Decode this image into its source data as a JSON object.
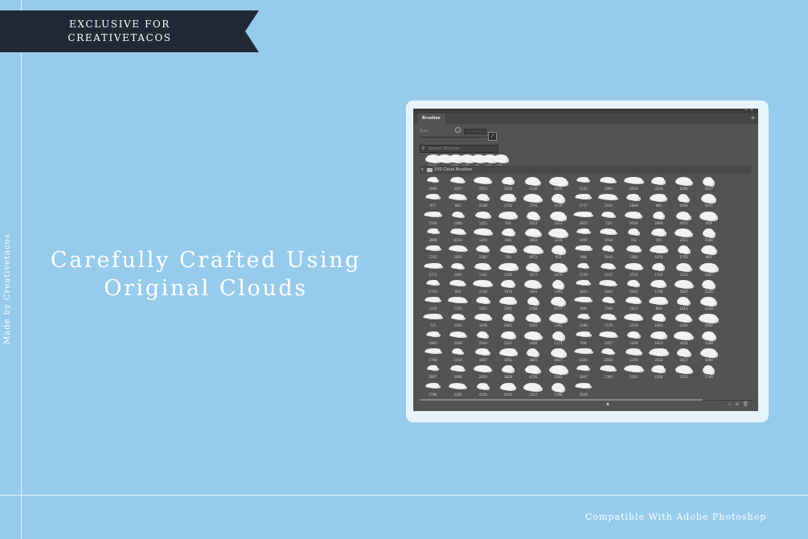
{
  "banner": {
    "line1": "EXCLUSIVE FOR",
    "line2": "CREATIVETACOS",
    "color": "#1f2a35"
  },
  "side_text": "Made by Creativetacos",
  "headline": {
    "line1": "Carefully Crafted Using",
    "line2": "Original Clouds"
  },
  "footer": "Compatible With Adobe Photoshop",
  "colors": {
    "background": "#96cbeb",
    "card": "#e7f3fb",
    "panel": "#535353"
  },
  "photoshop": {
    "panel_title": "Brushes",
    "size_label": "Size",
    "search_placeholder": "Search Brushes",
    "recent_sizes": [
      "1848",
      "",
      "2700",
      "125",
      "60",
      "200",
      "300"
    ],
    "folder_name": "150 Cloud Brushes",
    "brush_sizes": [
      "3994",
      "3447",
      "2553",
      "2810",
      "2136",
      "2975",
      "1150",
      "3904",
      "2058",
      "3333",
      "1500",
      "3017",
      "957",
      "882",
      "2148",
      "2723",
      "2795",
      "4770",
      "2737",
      "3184",
      "2849",
      "965",
      "2494",
      "1671",
      "1504",
      "1080",
      "1255",
      "531",
      "3512",
      "2231",
      "1823",
      "723",
      "2050",
      "2996",
      "4371",
      "959",
      "3896",
      "4154",
      "1254",
      "836",
      "3062",
      "2270",
      "1497",
      "1934",
      "701",
      "915",
      "2013",
      "1584",
      "1201",
      "1800",
      "2282",
      "784",
      "4072",
      "852",
      "968",
      "1910",
      "1582",
      "1616",
      "1755",
      "867",
      "2715",
      "1695",
      "1342",
      "1305",
      "1677",
      "2476",
      "1749",
      "1232",
      "3730",
      "1792",
      "2333",
      "1567",
      "1710",
      "862",
      "1159",
      "1910",
      "1491",
      "1491",
      "1853",
      "3604",
      "2640",
      "1798",
      "1827",
      "2230",
      "1226",
      "1355",
      "1652",
      "2581",
      "1768",
      "4777",
      "808",
      "1594",
      "1815",
      "806",
      "1911",
      "2108",
      "725",
      "1050",
      "1676",
      "2061",
      "1645",
      "1391",
      "1488",
      "1579",
      "2558",
      "1952",
      "2283",
      "2492",
      "1961",
      "2348",
      "2044",
      "2247",
      "1496",
      "1171",
      "938",
      "2457",
      "1468",
      "1921",
      "2035",
      "2268",
      "1794",
      "1154",
      "1857",
      "1852",
      "3881",
      "4437",
      "1245",
      "2930",
      "1370",
      "2032",
      "3627",
      "4484",
      "2807",
      "3696",
      "2050",
      "2820",
      "4726",
      "3243",
      "1647",
      "1369",
      "2263",
      "4248",
      "1251",
      "1748",
      "2786",
      "2285",
      "4204",
      "4410",
      "2357",
      "2788",
      "1848"
    ]
  }
}
